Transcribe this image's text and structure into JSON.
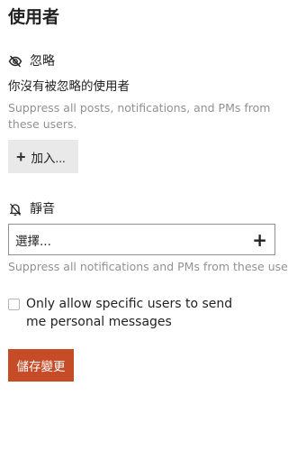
{
  "page": {
    "title": "使用者"
  },
  "ignore": {
    "icon": "eye-slash-icon",
    "heading": "忽略",
    "status": "你沒有被忽略的使用者",
    "description": "Suppress all posts, notifications, and PMs from these users.",
    "add_button_icon": "plus-icon",
    "add_button_label": "加入..."
  },
  "mute": {
    "icon": "bell-slash-icon",
    "heading": "靜音",
    "chooser_placeholder": "選擇...",
    "chooser_icon": "plus-icon",
    "description": "Suppress all notifications and PMs from these users."
  },
  "private_messages": {
    "allow_specific_label": "Only allow specific users to send me personal messages",
    "checked": false
  },
  "actions": {
    "save_label": "儲存變更",
    "save_color": "#c64b27"
  }
}
